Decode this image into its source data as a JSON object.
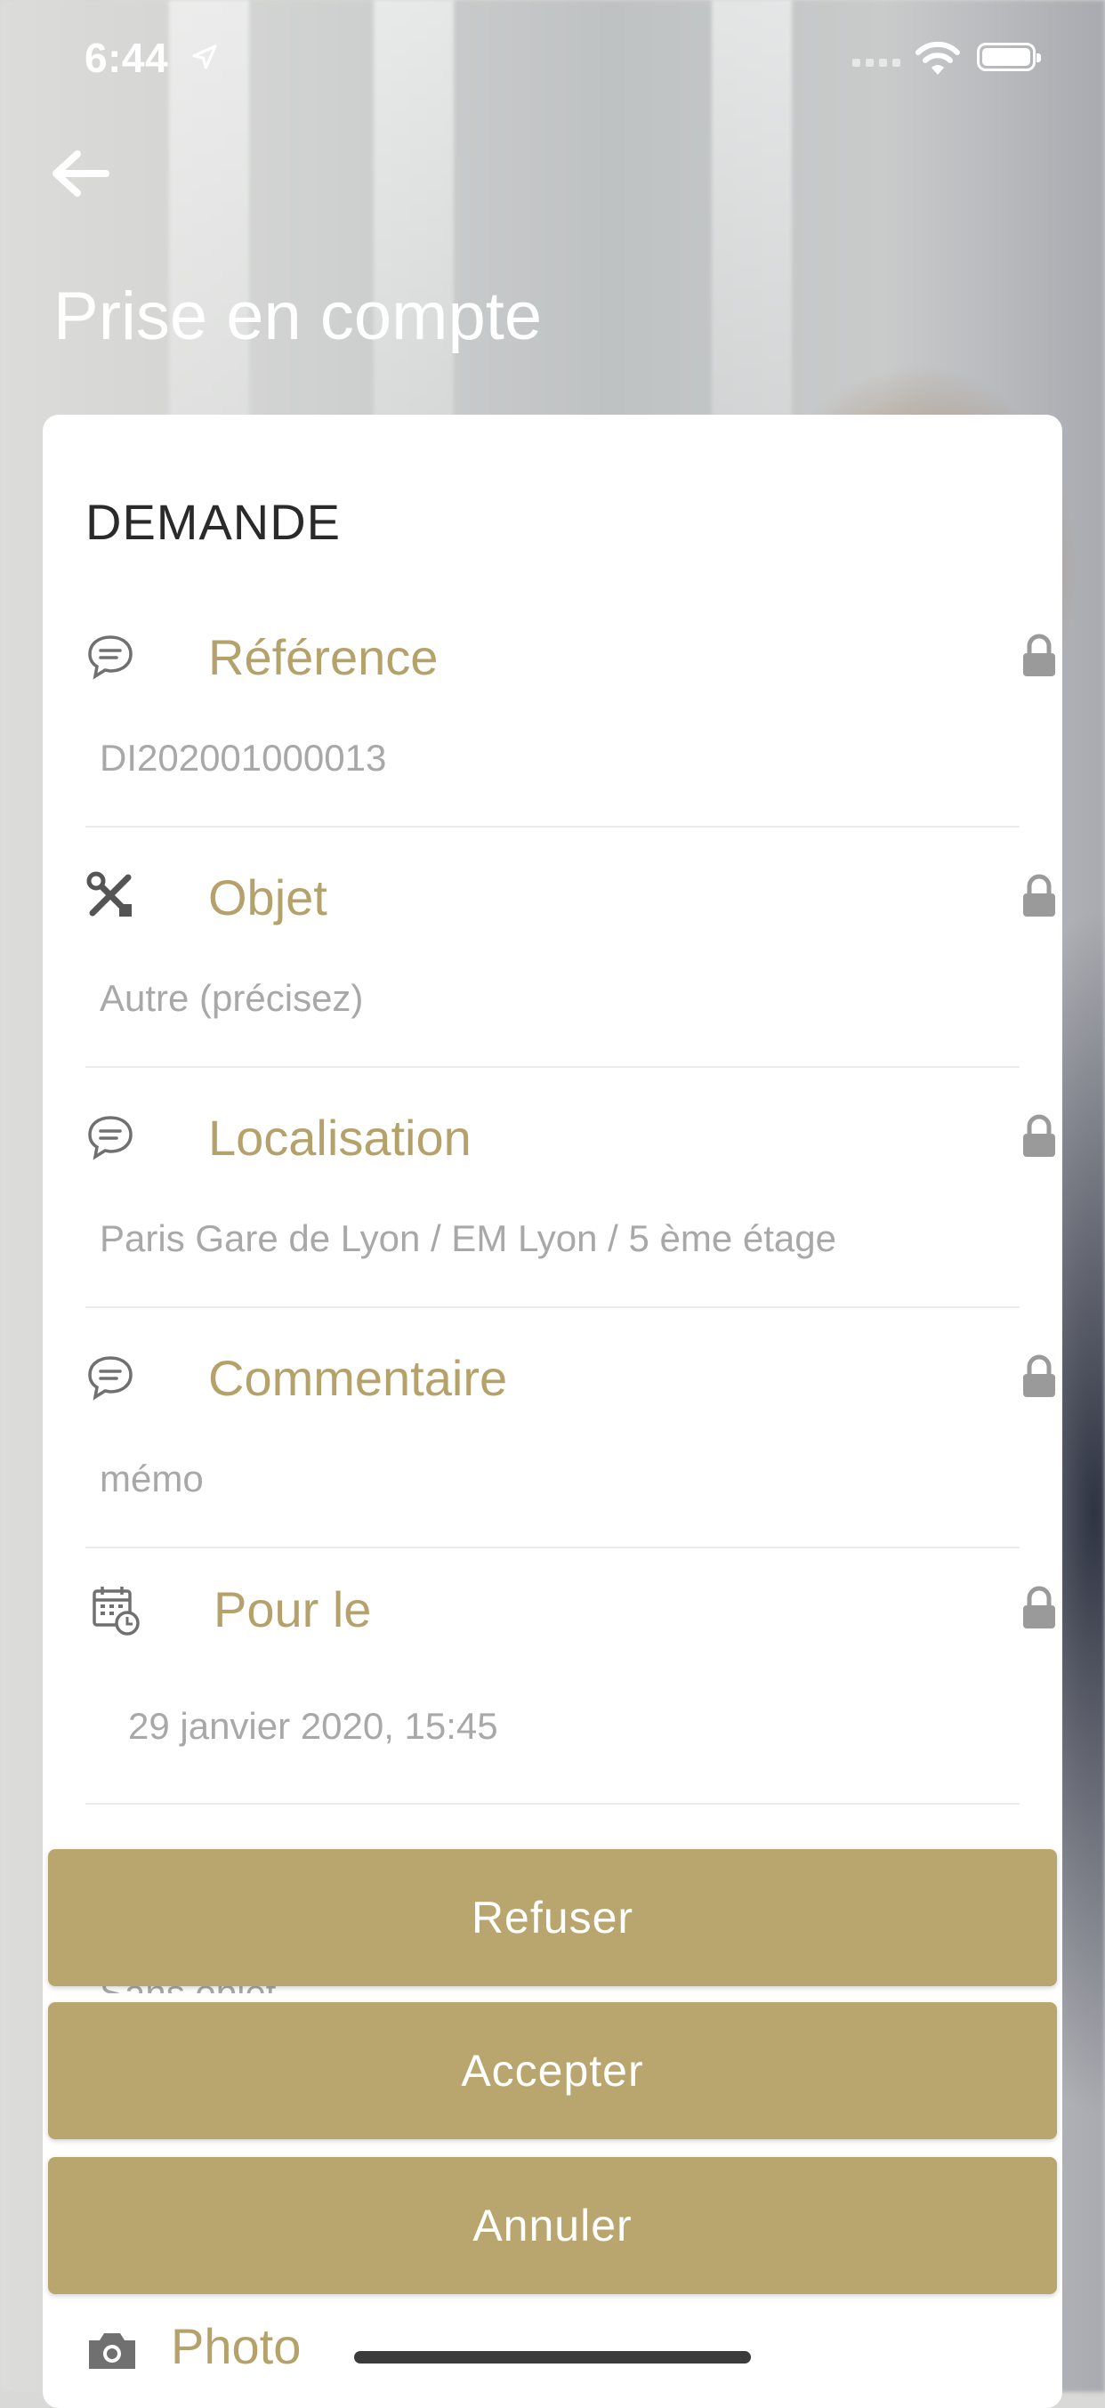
{
  "status_bar": {
    "time": "6:44"
  },
  "header": {
    "title": "Prise en compte"
  },
  "card": {
    "section_title": "DEMANDE",
    "fields": [
      {
        "label": "Référence",
        "value": "DI202001000013",
        "icon": "chat-bubble-icon",
        "locked": true
      },
      {
        "label": "Objet",
        "value": "Autre (précisez)",
        "icon": "tools-icon",
        "locked": true
      },
      {
        "label": "Localisation",
        "value": "Paris Gare de Lyon / EM Lyon / 5 ème étage",
        "icon": "chat-bubble-icon",
        "locked": true
      },
      {
        "label": "Commentaire",
        "value": "mémo",
        "icon": "chat-bubble-icon",
        "locked": true
      },
      {
        "label": "Pour le",
        "value": "29 janvier 2020, 15:45",
        "icon": "calendar-clock-icon",
        "locked": true
      }
    ],
    "partial_hidden_text": "Sans objet",
    "photo_label": "Photo"
  },
  "actions": {
    "refuse": "Refuser",
    "accept": "Accepter",
    "cancel": "Annuler"
  },
  "colors": {
    "accent": "#b9a66e",
    "label": "#b5a26a",
    "value": "#a8a8a8"
  }
}
